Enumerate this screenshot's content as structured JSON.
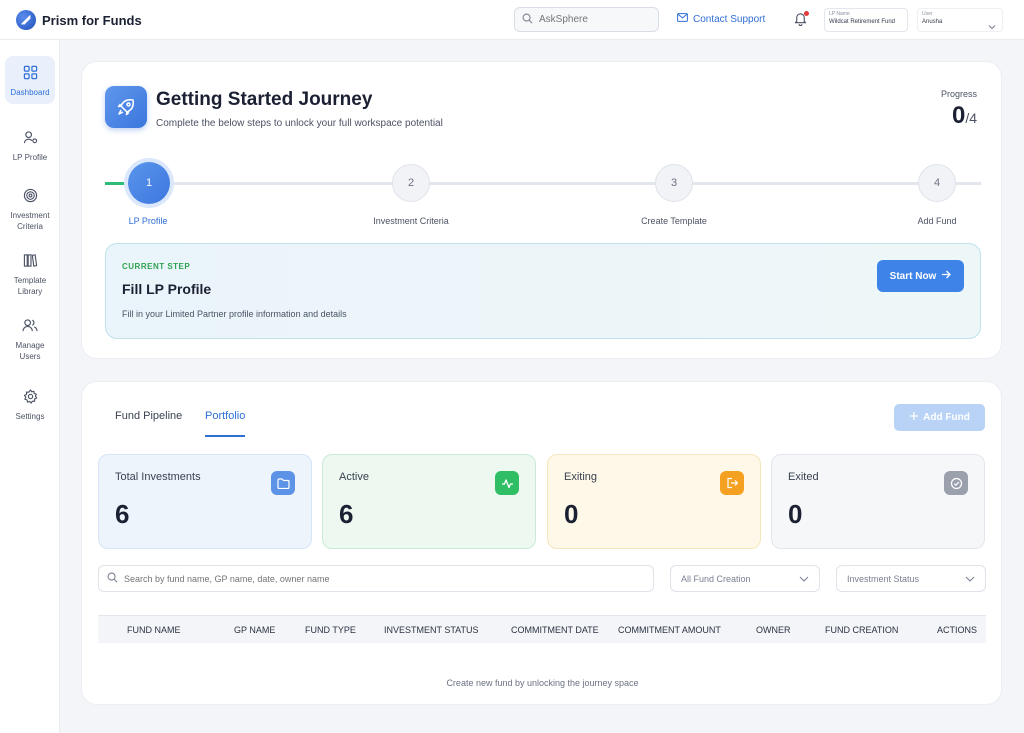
{
  "header": {
    "app_name": "Prism for Funds",
    "search_placeholder": "AskSphere",
    "contact_label": "Contact Support",
    "lp_label": "LP Name",
    "lp_value": "Wildcat Retirement Fund",
    "user_label": "User",
    "user_value": "Anusha"
  },
  "sidebar": {
    "items": [
      {
        "label": "Dashboard",
        "icon": "grid-icon",
        "active": true
      },
      {
        "label": "LP Profile",
        "icon": "user-settings-icon"
      },
      {
        "label": "Investment Criteria",
        "icon": "target-icon"
      },
      {
        "label": "Template Library",
        "icon": "library-icon"
      },
      {
        "label": "Manage Users",
        "icon": "users-icon"
      },
      {
        "label": "Settings",
        "icon": "gear-icon"
      }
    ]
  },
  "journey": {
    "title": "Getting Started Journey",
    "subtitle": "Complete the below steps to unlock your full workspace potential",
    "progress_label": "Progress",
    "progress_done": "0",
    "progress_total": "/4",
    "steps": [
      {
        "number": "1",
        "label": "LP Profile",
        "active": true
      },
      {
        "number": "2",
        "label": "Investment Criteria"
      },
      {
        "number": "3",
        "label": "Create Template"
      },
      {
        "number": "4",
        "label": "Add Fund"
      }
    ],
    "current": {
      "tag": "CURRENT STEP",
      "title": "Fill LP Profile",
      "description": "Fill in your Limited Partner profile information and details",
      "button_label": "Start Now"
    }
  },
  "portfolio": {
    "tabs": [
      {
        "label": "Fund Pipeline",
        "active": false
      },
      {
        "label": "Portfolio",
        "active": true
      }
    ],
    "add_fund_label": "Add Fund",
    "stats": [
      {
        "label": "Total Investments",
        "value": "6",
        "icon": "folder-icon",
        "bg": "#eef4fc",
        "border": "#d6e4f7",
        "icon_bg": "#5d93e6"
      },
      {
        "label": "Active",
        "value": "6",
        "icon": "activity-icon",
        "bg": "#ecf8f0",
        "border": "#cbebd6",
        "icon_bg": "#2fbe64"
      },
      {
        "label": "Exiting",
        "value": "0",
        "icon": "exit-icon",
        "bg": "#fdf8e7",
        "border": "#f4e6bd",
        "icon_bg": "#f4a020"
      },
      {
        "label": "Exited",
        "value": "0",
        "icon": "check-circle-icon",
        "bg": "#f6f7f9",
        "border": "#e3e6ec",
        "icon_bg": "#9aa1ad"
      }
    ],
    "search_placeholder": "Search by fund name, GP name, date, owner name",
    "filters": [
      {
        "label": "All Fund Creation"
      },
      {
        "label": "Investment Status"
      }
    ],
    "columns": [
      "FUND NAME",
      "GP NAME",
      "FUND TYPE",
      "INVESTMENT STATUS",
      "COMMITMENT DATE",
      "COMMITMENT AMOUNT",
      "OWNER",
      "FUND CREATION",
      "ACTIONS"
    ],
    "empty_message": "Create new fund by unlocking the journey space"
  }
}
